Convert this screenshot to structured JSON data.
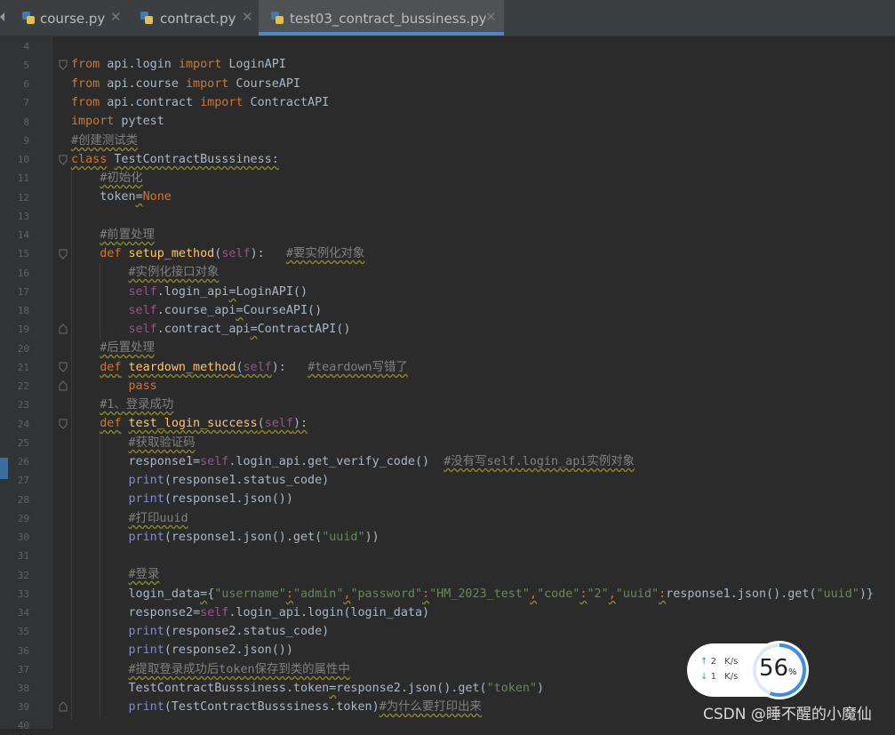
{
  "tabs": [
    {
      "label": "course.py",
      "active": false
    },
    {
      "label": "contract.py",
      "active": false
    },
    {
      "label": "test03_contract_bussiness.py",
      "active": true
    }
  ],
  "line_numbers": [
    "4",
    "5",
    "6",
    "7",
    "8",
    "9",
    "10",
    "11",
    "12",
    "13",
    "14",
    "15",
    "16",
    "17",
    "18",
    "19",
    "20",
    "21",
    "22",
    "23",
    "24",
    "25",
    "26",
    "27",
    "28",
    "29",
    "30",
    "31",
    "32",
    "33",
    "34",
    "35",
    "36",
    "37",
    "38",
    "39",
    "40"
  ],
  "code": {
    "l5": [
      "from",
      " api.login ",
      "import",
      " LoginAPI"
    ],
    "l6": [
      "from",
      " api.course ",
      "import",
      " CourseAPI"
    ],
    "l7": [
      "from",
      " api.contract ",
      "import",
      " ContractAPI"
    ],
    "l8": [
      "import",
      " pytest"
    ],
    "l9": [
      "#创建测试类"
    ],
    "l10": [
      "class",
      " ",
      "TestContractBusssiness:"
    ],
    "l11": [
      "    ",
      "#初始化"
    ],
    "l12": [
      "    token",
      "=",
      "None"
    ],
    "l14": [
      "    ",
      "#前置处理"
    ],
    "l15": [
      "    ",
      "def",
      " ",
      "setup_method",
      "(",
      "self",
      "):   ",
      "#要实例化对象"
    ],
    "l16": [
      "        ",
      "#实例化接口对象"
    ],
    "l17": [
      "        ",
      "self",
      ".login_api",
      "=",
      "LoginAPI()"
    ],
    "l18": [
      "        ",
      "self",
      ".course_api",
      "=",
      "CourseAPI()"
    ],
    "l19": [
      "        ",
      "self",
      ".contract_api",
      "=",
      "ContractAPI()"
    ],
    "l20": [
      "    ",
      "#后置处理"
    ],
    "l21": [
      "    ",
      "def",
      " ",
      "teardown_method",
      "(",
      "self",
      "):   ",
      "#teardown写错了"
    ],
    "l22": [
      "        ",
      "pass"
    ],
    "l23": [
      "    ",
      "#1、登录成功"
    ],
    "l24": [
      "    ",
      "def",
      " ",
      "test_login_success",
      "(",
      "self",
      "):"
    ],
    "l25": [
      "        ",
      "#获取验证码"
    ],
    "l26": [
      "        response1",
      "=",
      "self",
      ".login_api.get_verify_code()  ",
      "#没有写self.login_api实例对象"
    ],
    "l27": [
      "        ",
      "print",
      "(response1.status_code)"
    ],
    "l28": [
      "        ",
      "print",
      "(response1.json())"
    ],
    "l29": [
      "        ",
      "#打印uuid"
    ],
    "l30": [
      "        ",
      "print",
      "(response1.json().get(",
      "\"uuid\"",
      "))"
    ],
    "l32": [
      "        ",
      "#登录"
    ],
    "l33": [
      "        login_data",
      "=",
      "{",
      "\"username\"",
      ":",
      "\"admin\"",
      ",",
      "\"password\"",
      ":",
      "\"HM_2023_test\"",
      ",",
      "\"code\"",
      ":",
      "\"2\"",
      ",",
      "\"uuid\"",
      ":",
      "response1.json().get(",
      "\"uuid\"",
      ")}"
    ],
    "l34": [
      "        response2",
      "=",
      "self",
      ".login_api.login(login_data)"
    ],
    "l35": [
      "        ",
      "print",
      "(response2.status_code)"
    ],
    "l36": [
      "        ",
      "print",
      "(response2.json())"
    ],
    "l37": [
      "        ",
      "#提取登录成功后token保存到类的属性中"
    ],
    "l38": [
      "        TestContractBusssiness.token",
      "=",
      "response2.json().get(",
      "\"token\"",
      ")"
    ],
    "l39": [
      "        ",
      "print",
      "(TestContractBusssiness.token)",
      "#为什么要打印出来"
    ]
  },
  "net_widget": {
    "up_arrow": "↑",
    "up_value": "2",
    "up_unit": "K/s",
    "down_arrow": "↓",
    "down_value": "1",
    "down_unit": "K/s",
    "percent_value": "56",
    "percent_sign": "%",
    "percent_fraction": 0.56
  },
  "watermark": "CSDN @睡不醒的小魔仙",
  "colors": {
    "keyword": "#cc7832",
    "comment": "#808080",
    "string": "#6a8759",
    "self": "#94558d",
    "function": "#ffc66d",
    "accent": "#4a88c7"
  }
}
